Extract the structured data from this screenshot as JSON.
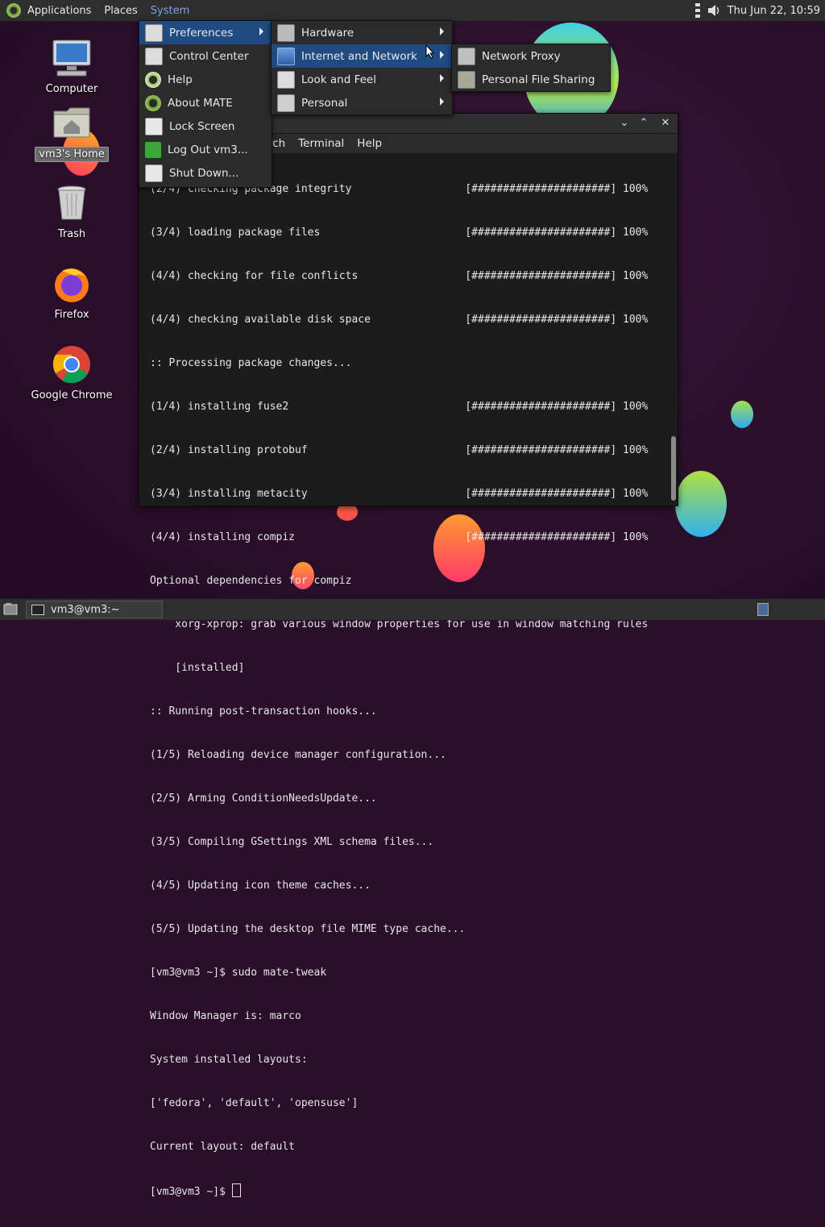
{
  "top_panel": {
    "menus": [
      "Applications",
      "Places",
      "System"
    ],
    "clock": "Thu Jun 22, 10:59"
  },
  "desktop_icons": [
    {
      "label": "Computer",
      "icon": "computer-icon"
    },
    {
      "label": "vm3's Home",
      "icon": "home-folder-icon"
    },
    {
      "label": "Trash",
      "icon": "trash-icon"
    },
    {
      "label": "Firefox",
      "icon": "firefox-icon"
    },
    {
      "label": "Google Chrome",
      "icon": "chrome-icon"
    }
  ],
  "system_menu": {
    "items": [
      "Preferences",
      "Control Center",
      "Help",
      "About MATE",
      "Lock Screen",
      "Log Out vm3...",
      "Shut Down..."
    ]
  },
  "preferences_menu": {
    "items": [
      "Hardware",
      "Internet and Network",
      "Look and Feel",
      "Personal"
    ]
  },
  "internet_menu": {
    "items": [
      "Network Proxy",
      "Personal File Sharing"
    ]
  },
  "terminal": {
    "menubar": [
      "rch",
      "Terminal",
      "Help"
    ],
    "lines": [
      "(2/4) checking package integrity                  [######################] 100%",
      "(3/4) loading package files                       [######################] 100%",
      "(4/4) checking for file conflicts                 [######################] 100%",
      "(4/4) checking available disk space               [######################] 100%",
      ":: Processing package changes...",
      "(1/4) installing fuse2                            [######################] 100%",
      "(2/4) installing protobuf                         [######################] 100%",
      "(3/4) installing metacity                         [######################] 100%",
      "(4/4) installing compiz                           [######################] 100%",
      "Optional dependencies for compiz",
      "    xorg-xprop: grab various window properties for use in window matching rules",
      "    [installed]",
      ":: Running post-transaction hooks...",
      "(1/5) Reloading device manager configuration...",
      "(2/5) Arming ConditionNeedsUpdate...",
      "(3/5) Compiling GSettings XML schema files...",
      "(4/5) Updating icon theme caches...",
      "(5/5) Updating the desktop file MIME type cache...",
      "[vm3@vm3 ~]$ sudo mate-tweak",
      "Window Manager is: marco",
      "System installed layouts:",
      "['fedora', 'default', 'opensuse']",
      "Current layout: default",
      "[vm3@vm3 ~]$ "
    ]
  },
  "taskbar": {
    "task_label": "vm3@vm3:~"
  },
  "colors": {
    "menu_highlight": "#1f4a82",
    "active_menu_text": "#7ea7e6",
    "panel_bg": "#2e2e2e"
  }
}
